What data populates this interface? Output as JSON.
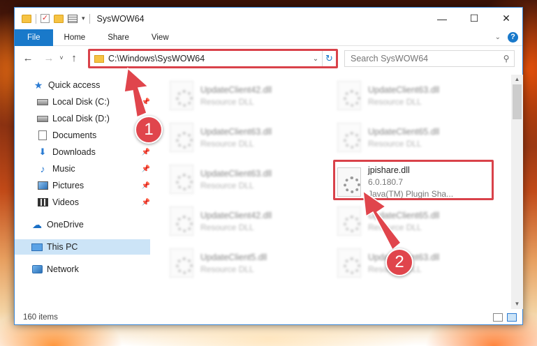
{
  "window": {
    "title": "SysWOW64",
    "controls": {
      "minimize": "—",
      "maximize": "☐",
      "close": "✕"
    }
  },
  "ribbon": {
    "tabs": [
      "File",
      "Home",
      "Share",
      "View"
    ]
  },
  "navigation": {
    "back": "←",
    "forward": "→",
    "recent": "˅",
    "up": "↑",
    "address": "C:\\Windows\\SysWOW64",
    "search_placeholder": "Search SysWOW64"
  },
  "sidebar": {
    "items": [
      {
        "label": "Quick access",
        "icon": "star-icon"
      },
      {
        "label": "Local Disk (C:)",
        "icon": "disk-icon",
        "pinned": true
      },
      {
        "label": "Local Disk (D:)",
        "icon": "disk-icon",
        "pinned": false
      },
      {
        "label": "Documents",
        "icon": "documents-icon",
        "pinned": true
      },
      {
        "label": "Downloads",
        "icon": "downloads-icon",
        "pinned": true
      },
      {
        "label": "Music",
        "icon": "music-icon",
        "pinned": true
      },
      {
        "label": "Pictures",
        "icon": "pictures-icon",
        "pinned": true
      },
      {
        "label": "Videos",
        "icon": "videos-icon",
        "pinned": true
      },
      {
        "label": "OneDrive",
        "icon": "onedrive-icon"
      },
      {
        "label": "This PC",
        "icon": "this-pc-icon",
        "selected": true
      },
      {
        "label": "Network",
        "icon": "network-icon"
      }
    ]
  },
  "files": [
    {
      "name": "UpdateClient42.dll",
      "type": "Resource DLL",
      "blurred": true
    },
    {
      "name": "UpdateClient63.dll",
      "type": "Resource DLL",
      "blurred": true
    },
    {
      "name": "UpdateClient63.dll",
      "type": "Resource DLL",
      "blurred": true
    },
    {
      "name": "UpdateClient65.dll",
      "type": "Resource DLL",
      "blurred": true
    },
    {
      "name": "UpdateClient63.dll",
      "type": "Resource DLL",
      "blurred": true
    },
    {
      "name": "jpishare.dll",
      "version": "6.0.180.7",
      "description": "Java(TM) Plugin Sha...",
      "blurred": false,
      "highlighted": true
    },
    {
      "name": "UpdateClient42.dll",
      "type": "Resource DLL",
      "blurred": true
    },
    {
      "name": "UpdateClient65.dll",
      "type": "Resource DLL",
      "blurred": true
    },
    {
      "name": "UpdateClient5.dll",
      "type": "Resource DLL",
      "blurred": true
    },
    {
      "name": "UpdateClient63.dll",
      "type": "Resource DLL",
      "blurred": true
    }
  ],
  "status": {
    "item_count": "160 items"
  },
  "callouts": [
    "1",
    "2"
  ],
  "colors": {
    "accent": "#1979ca",
    "highlight": "#d9424a",
    "selected": "#cce4f7"
  }
}
